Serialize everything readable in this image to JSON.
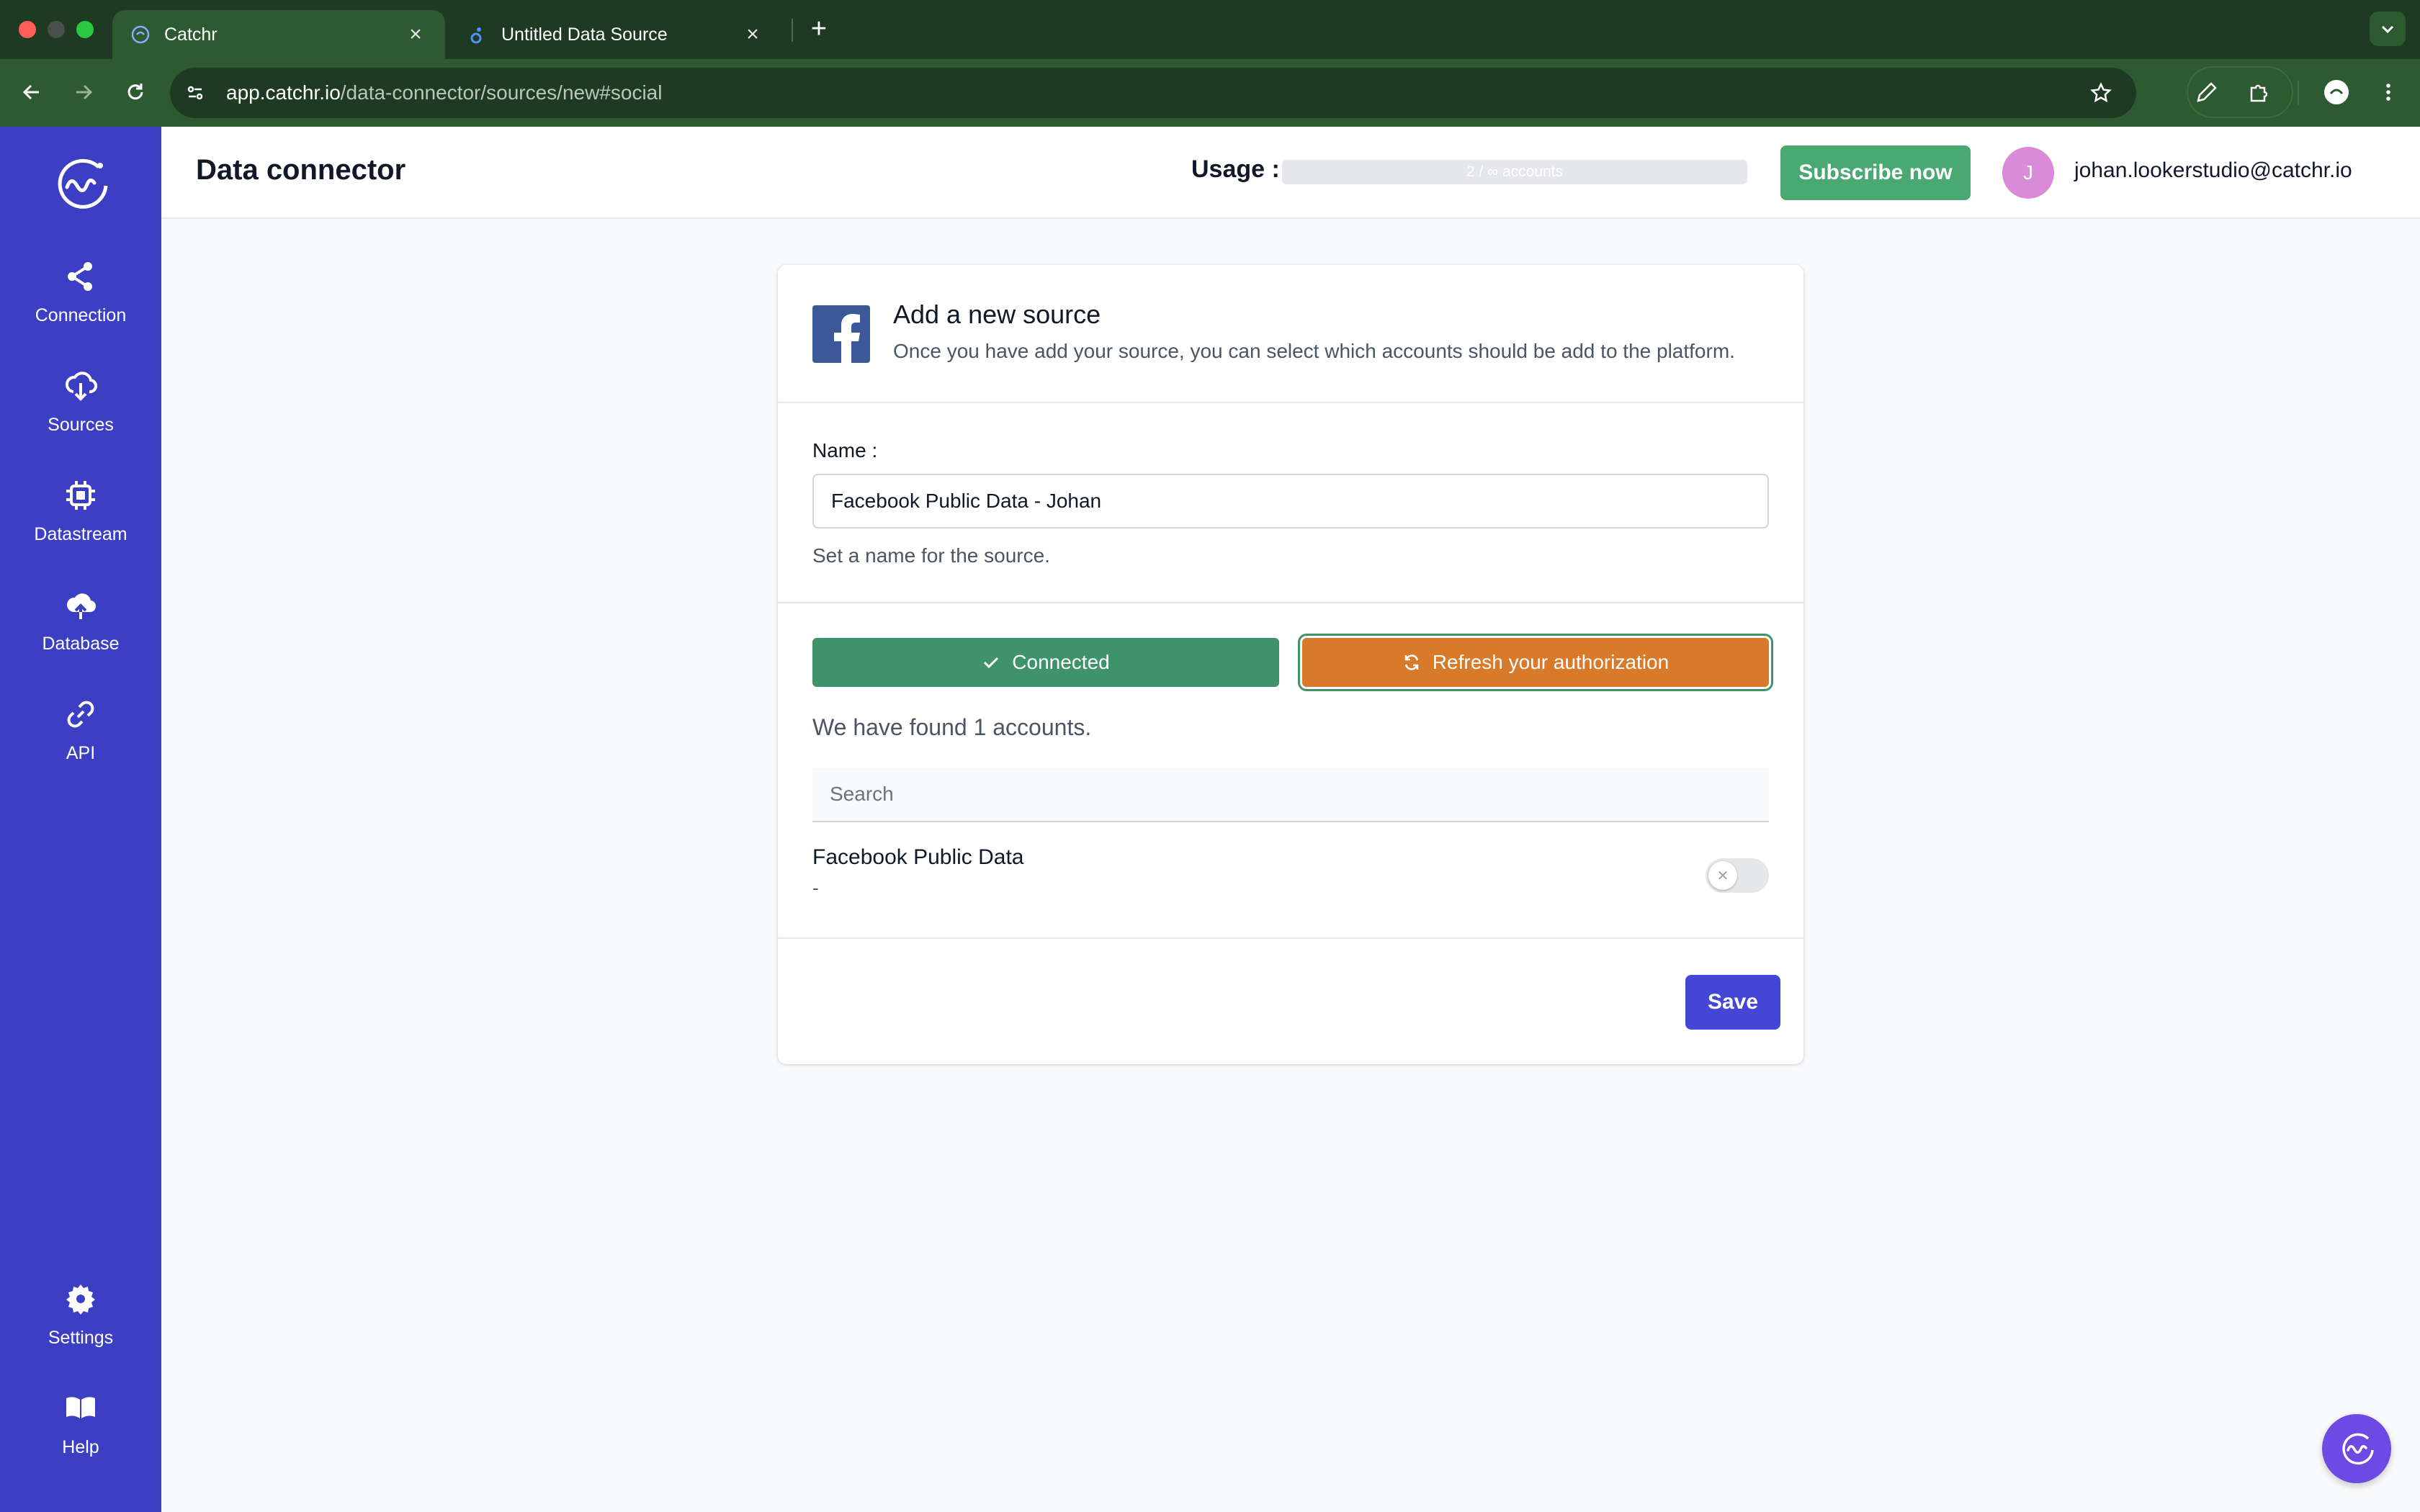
{
  "browser": {
    "tabs": [
      {
        "title": "Catchr",
        "active": true
      },
      {
        "title": "Untitled Data Source",
        "active": false
      }
    ],
    "new_tab_symbol": "+",
    "close_symbol": "×",
    "url_host": "app.catchr.io",
    "url_path": "/data-connector/sources/new#social"
  },
  "sidebar": {
    "items": [
      {
        "label": "Connection",
        "icon": "share-icon"
      },
      {
        "label": "Sources",
        "icon": "cloud-download-icon"
      },
      {
        "label": "Datastream",
        "icon": "chip-icon"
      },
      {
        "label": "Database",
        "icon": "cloud-upload-icon"
      },
      {
        "label": "API",
        "icon": "link-icon"
      }
    ],
    "bottom_items": [
      {
        "label": "Settings",
        "icon": "gear-icon"
      },
      {
        "label": "Help",
        "icon": "book-icon"
      }
    ]
  },
  "header": {
    "title": "Data connector",
    "usage_label": "Usage :",
    "usage_text": "2 / ∞ accounts",
    "subscribe_label": "Subscribe now",
    "avatar_initial": "J",
    "user_email": "johan.lookerstudio@catchr.io"
  },
  "card": {
    "title": "Add a new source",
    "subtitle": "Once you have add your source, you can select which accounts should be add to the platform.",
    "name_label": "Name :",
    "name_value": "Facebook Public Data - Johan",
    "name_help": "Set a name for the source.",
    "connected_label": "Connected",
    "refresh_label": "Refresh your authorization",
    "found_text": "We have found 1 accounts.",
    "search_placeholder": "Search",
    "accounts": [
      {
        "name": "Facebook Public Data",
        "sub": "-",
        "enabled": false
      }
    ],
    "save_label": "Save"
  },
  "colors": {
    "sidebar": "#3c3fc4",
    "connected": "#3f936a",
    "refresh": "#d97a2b",
    "save": "#4446d6",
    "subscribe": "#4aa873"
  }
}
